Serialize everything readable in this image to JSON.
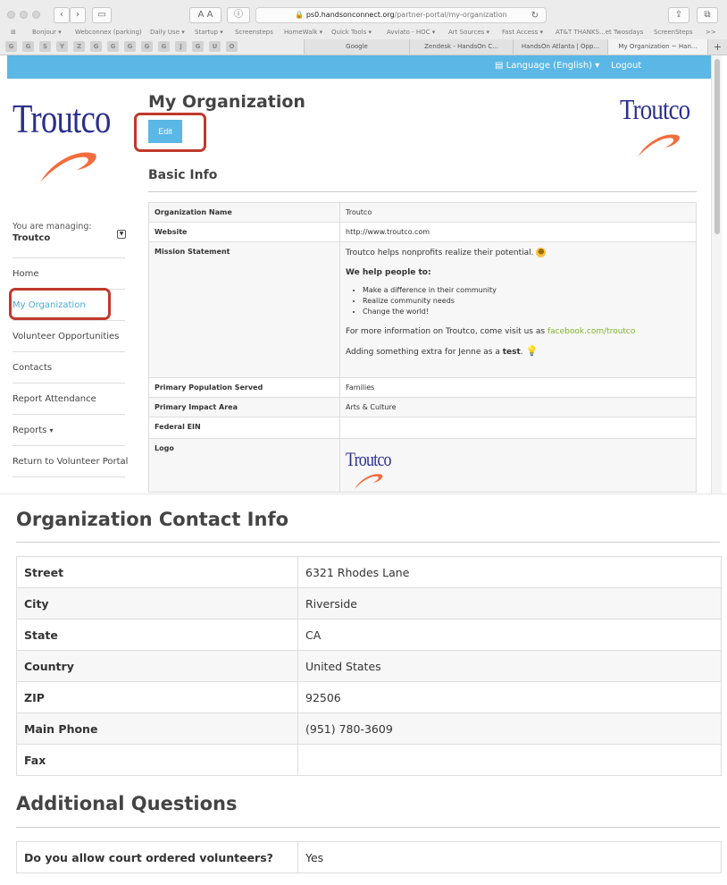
{
  "browser": {
    "url_host": "ps0.handsonconnect.org",
    "url_path": "/partner-portal/my-organization",
    "reader_label": "A A",
    "bookmarks": [
      "Bonjour ▾",
      "Webconnex (parking)",
      "Daily Use ▾",
      "Startup ▾",
      "Screensteps",
      "HomeWalk ▾",
      "Quick Tools ▾",
      "Avviato - HOC ▾",
      "Art Sources ▾",
      "Fast Access ▾",
      "AT&T THANKS...et Twosdays",
      "ScreenSteps",
      ">>"
    ],
    "favicons": [
      "G",
      "G",
      "S",
      "Y",
      "Z",
      "G",
      "G",
      "G",
      "G",
      "G",
      "J",
      "G",
      "U",
      "O"
    ],
    "tabs": [
      "Google",
      "Zendesk - HandsOn C...",
      "HandsOn Atlanta | Opp...",
      "My Organization ~ Han..."
    ]
  },
  "topbar": {
    "language": "Language (English) ▾",
    "logout": "Logout"
  },
  "logo": {
    "text": "Troutco"
  },
  "sidebar": {
    "managing_label": "You are managing:",
    "managing_value": "Troutco",
    "items": [
      {
        "label": "Home"
      },
      {
        "label": "My Organization"
      },
      {
        "label": "Volunteer Opportunities"
      },
      {
        "label": "Contacts"
      },
      {
        "label": "Report Attendance"
      },
      {
        "label": "Reports"
      },
      {
        "label": "Return to Volunteer Portal"
      }
    ],
    "reports_caret": "▾"
  },
  "main": {
    "title": "My Organization",
    "edit_label": "Edit",
    "basic_info_title": "Basic Info",
    "rows": {
      "org_name": {
        "key": "Organization Name",
        "value": "Troutco"
      },
      "website": {
        "key": "Website",
        "value": "http://www.troutco.com"
      },
      "mission": {
        "key": "Mission Statement",
        "line1": "Troutco helps nonprofits realize their potential.",
        "bold_line": "We help people to:",
        "bullets": [
          "Make a difference in their community",
          "Realize community needs",
          "Change the world!"
        ],
        "more_prefix": "For more information on Troutco, come visit us as",
        "more_link": "facebook.com/troutco",
        "extra_prefix": "Adding something extra for Jenne as a",
        "extra_bold": "test",
        "extra_suffix": "."
      },
      "population": {
        "key": "Primary Population Served",
        "value": "Families"
      },
      "impact": {
        "key": "Primary Impact Area",
        "value": "Arts & Culture"
      },
      "ein": {
        "key": "Federal EIN",
        "value": ""
      },
      "logo": {
        "key": "Logo"
      }
    }
  },
  "contact": {
    "title": "Organization Contact Info",
    "rows": [
      {
        "key": "Street",
        "value": "6321 Rhodes Lane"
      },
      {
        "key": "City",
        "value": "Riverside"
      },
      {
        "key": "State",
        "value": "CA"
      },
      {
        "key": "Country",
        "value": "United States"
      },
      {
        "key": "ZIP",
        "value": "92506"
      },
      {
        "key": "Main Phone",
        "value": "(951) 780-3609"
      },
      {
        "key": "Fax",
        "value": ""
      }
    ]
  },
  "additional": {
    "title": "Additional Questions",
    "rows": [
      {
        "key": "Do you allow court ordered volunteers?",
        "value": "Yes"
      }
    ]
  }
}
